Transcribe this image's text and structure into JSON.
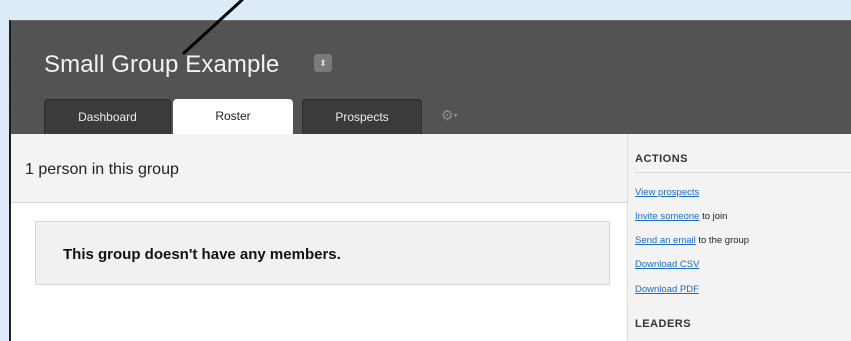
{
  "group": {
    "title": "Small Group Example",
    "caret": "⬍"
  },
  "tabs": [
    {
      "label": "Dashboard"
    },
    {
      "label": "Roster"
    },
    {
      "label": "Prospects"
    }
  ],
  "settings": {
    "icon": "gear-icon",
    "glyph": "⚙",
    "caret": "▾"
  },
  "roster": {
    "count_text": "1 person in this group",
    "empty_message": "This group doesn't have any members."
  },
  "sidebar": {
    "actions_heading": "ACTIONS",
    "actions": [
      {
        "link": "View prospects",
        "rest": ""
      },
      {
        "link": "Invite someone",
        "rest": " to join"
      },
      {
        "link": "Send an email",
        "rest": " to the group"
      },
      {
        "link": "Download CSV",
        "rest": ""
      },
      {
        "link": "Download PDF",
        "rest": ""
      }
    ],
    "leaders_heading": "LEADERS"
  }
}
